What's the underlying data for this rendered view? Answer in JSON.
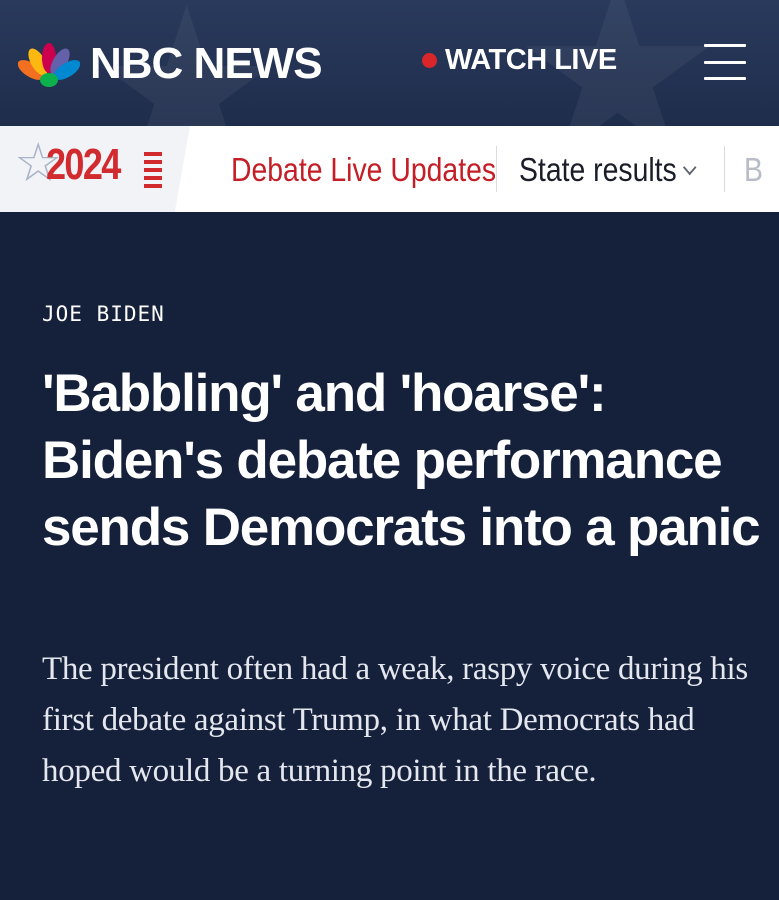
{
  "header": {
    "logo_text": "NBC NEWS",
    "watch_live_label": "WATCH LIVE",
    "colors": {
      "background": "#1f2d4c",
      "live_dot": "#d9262a"
    }
  },
  "subnav": {
    "badge_year": "2024",
    "items": [
      {
        "label": "Debate Live Updates"
      },
      {
        "label": "State results"
      },
      {
        "label": "B"
      }
    ],
    "colors": {
      "accent": "#c41e27"
    }
  },
  "article": {
    "eyebrow": "JOE BIDEN",
    "headline": "'Babbling' and 'hoarse': Biden's debate performance sends Democrats into a panic",
    "dek": "The president often had a weak, raspy voice during his first debate against Trump, in what Democrats had hoped would be a turning point in the race.",
    "colors": {
      "background": "#15203a"
    }
  },
  "icons": [
    "nbc-peacock-icon",
    "live-dot-icon",
    "hamburger-menu-icon",
    "star-icon",
    "chevron-down-icon"
  ]
}
